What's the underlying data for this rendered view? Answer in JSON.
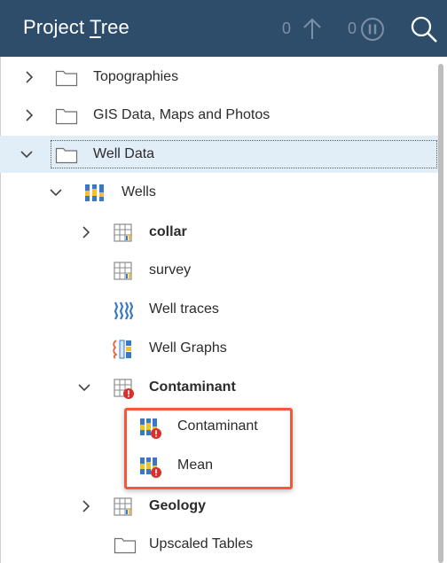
{
  "app": {
    "title_pre": "Project ",
    "title_underlined": "T",
    "title_post": "ree",
    "upload_count": "0",
    "pause_count": "0"
  },
  "tree": [
    {
      "label": "Topographies",
      "bold": false,
      "icon": "folder-icon",
      "expander": "collapsed"
    },
    {
      "label": "GIS Data, Maps and Photos",
      "bold": false,
      "icon": "folder-icon",
      "expander": "collapsed"
    },
    {
      "label": "Well Data",
      "bold": false,
      "icon": "folder-icon",
      "expander": "expanded",
      "selected": true
    },
    {
      "label": "Wells",
      "bold": false,
      "icon": "wells-icon",
      "expander": "expanded"
    },
    {
      "label": "collar",
      "bold": true,
      "icon": "table-icon",
      "expander": "collapsed"
    },
    {
      "label": "survey",
      "bold": false,
      "icon": "table-icon",
      "expander": "none"
    },
    {
      "label": "Well traces",
      "bold": false,
      "icon": "well-traces-icon",
      "expander": "none"
    },
    {
      "label": "Well Graphs",
      "bold": false,
      "icon": "well-graphs-icon",
      "expander": "none"
    },
    {
      "label": "Contaminant",
      "bold": true,
      "icon": "table-error-icon",
      "expander": "expanded"
    },
    {
      "label": "Contaminant",
      "bold": false,
      "icon": "interval-error-icon",
      "expander": "none"
    },
    {
      "label": "Mean",
      "bold": false,
      "icon": "interval-error-icon",
      "expander": "none"
    },
    {
      "label": "Geology",
      "bold": true,
      "icon": "table-icon",
      "expander": "collapsed"
    },
    {
      "label": "Upscaled Tables",
      "bold": false,
      "icon": "folder-icon",
      "expander": "none"
    }
  ],
  "colors": {
    "header_bg": "#2d4d6b",
    "selection_bg": "#e1edf7",
    "highlight_border": "#ef5a3c",
    "error_badge": "#d9302c"
  }
}
